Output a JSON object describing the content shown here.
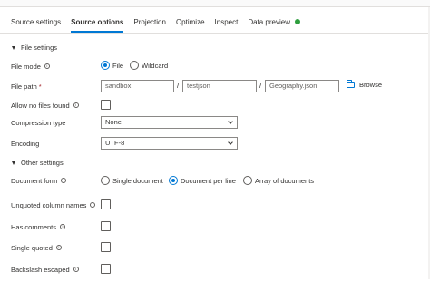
{
  "tabs": [
    {
      "label": "Source settings",
      "active": false
    },
    {
      "label": "Source options",
      "active": true
    },
    {
      "label": "Projection",
      "active": false
    },
    {
      "label": "Optimize",
      "active": false
    },
    {
      "label": "Inspect",
      "active": false
    },
    {
      "label": "Data preview",
      "active": false
    }
  ],
  "data_preview_status_color": "#2e9e3e",
  "accent_color": "#0078d4",
  "file_settings": {
    "section_title": "File settings",
    "file_mode": {
      "label": "File mode",
      "options": [
        "File",
        "Wildcard"
      ],
      "selected": "File"
    },
    "file_path": {
      "label": "File path",
      "required_marker": "*",
      "container": "sandbox",
      "directory": "testjson",
      "file": "Geography.json",
      "separator": "/",
      "browse_label": "Browse"
    },
    "allow_no_files": {
      "label": "Allow no files found",
      "checked": false
    },
    "compression_type": {
      "label": "Compression type",
      "value": "None"
    },
    "encoding": {
      "label": "Encoding",
      "value": "UTF-8"
    }
  },
  "other_settings": {
    "section_title": "Other settings",
    "document_form": {
      "label": "Document form",
      "options": [
        "Single document",
        "Document per line",
        "Array of documents"
      ],
      "selected": "Document per line"
    },
    "unquoted_column_names": {
      "label": "Unquoted column names",
      "checked": false
    },
    "has_comments": {
      "label": "Has comments",
      "checked": false
    },
    "single_quoted": {
      "label": "Single quoted",
      "checked": false
    },
    "backslash_escaped": {
      "label": "Backslash escaped",
      "checked": false
    }
  },
  "info_icon_glyph": "i"
}
